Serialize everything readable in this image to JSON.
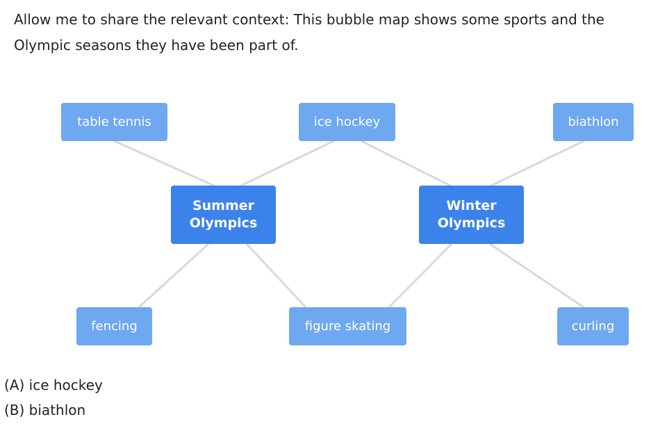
{
  "context": "Allow me to share the relevant context: This bubble map shows some sports and the Olympic seasons they have been part of.",
  "hubs": {
    "summer": "Summer\nOlympics",
    "winter": "Winter\nOlympics"
  },
  "sports": {
    "table_tennis": "table tennis",
    "ice_hockey": "ice hockey",
    "biathlon": "biathlon",
    "fencing": "fencing",
    "figure_skating": "figure skating",
    "curling": "curling"
  },
  "edges": [
    [
      "table_tennis",
      "summer"
    ],
    [
      "ice_hockey",
      "summer"
    ],
    [
      "ice_hockey",
      "winter"
    ],
    [
      "biathlon",
      "winter"
    ],
    [
      "fencing",
      "summer"
    ],
    [
      "figure_skating",
      "summer"
    ],
    [
      "figure_skating",
      "winter"
    ],
    [
      "curling",
      "winter"
    ]
  ],
  "choices": [
    "(A) ice hockey",
    "(B) biathlon"
  ],
  "colors": {
    "hub": "#3b82eb",
    "leaf": "#6ea8f0",
    "edge": "#d9d9d9"
  }
}
